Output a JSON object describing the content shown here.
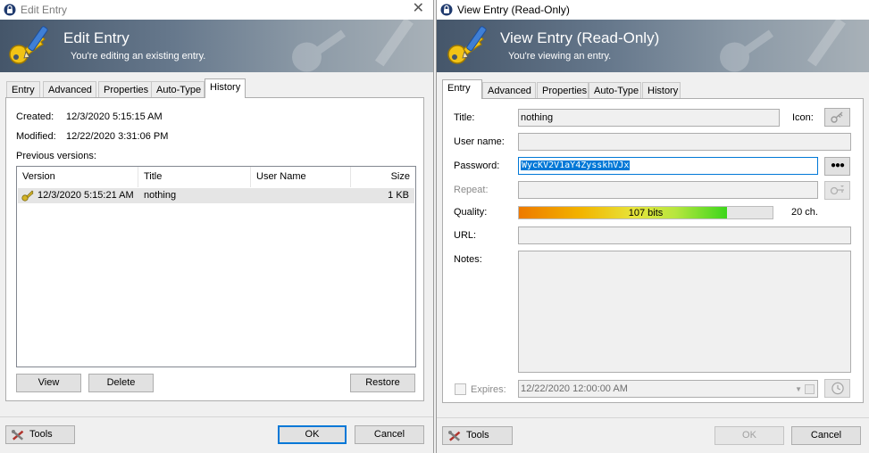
{
  "left": {
    "title": "Edit Entry",
    "banner_title": "Edit Entry",
    "banner_subtitle": "You're editing an existing entry.",
    "tabs": [
      "Entry",
      "Advanced",
      "Properties",
      "Auto-Type",
      "History"
    ],
    "active_tab": "History",
    "created_label": "Created:",
    "created_value": "12/3/2020 5:15:15 AM",
    "modified_label": "Modified:",
    "modified_value": "12/22/2020 3:31:06 PM",
    "previous_versions_label": "Previous versions:",
    "columns": [
      "Version",
      "Title",
      "User Name",
      "Size"
    ],
    "rows": [
      {
        "version": "12/3/2020 5:15:21 AM",
        "title": "nothing",
        "user_name": "",
        "size": "1 KB"
      }
    ],
    "view_label": "View",
    "delete_label": "Delete",
    "restore_label": "Restore",
    "tools_label": "Tools",
    "ok_label": "OK",
    "cancel_label": "Cancel"
  },
  "right": {
    "title": "View Entry (Read-Only)",
    "banner_title": "View Entry (Read-Only)",
    "banner_subtitle": "You're viewing an entry.",
    "tabs": [
      "Entry",
      "Advanced",
      "Properties",
      "Auto-Type",
      "History"
    ],
    "active_tab": "Entry",
    "title_label": "Title:",
    "title_value": "nothing",
    "icon_label": "Icon:",
    "username_label": "User name:",
    "username_value": "",
    "password_label": "Password:",
    "password_value": "WycKV2V1aY4ZysskhVJx",
    "reveal_label": "●●●",
    "repeat_label": "Repeat:",
    "repeat_value": "",
    "quality_label": "Quality:",
    "quality_bits": "107 bits",
    "quality_fraction": 0.82,
    "quality_chars": "20 ch.",
    "url_label": "URL:",
    "url_value": "",
    "notes_label": "Notes:",
    "notes_value": "",
    "expires_label": "Expires:",
    "expires_value": "12/22/2020 12:00:00 AM",
    "tools_label": "Tools",
    "ok_label": "OK",
    "cancel_label": "Cancel"
  },
  "colors": {
    "accent_focus": "#0078d7",
    "selection": "#0078d7",
    "row_highlight": "#e5e5e5"
  }
}
